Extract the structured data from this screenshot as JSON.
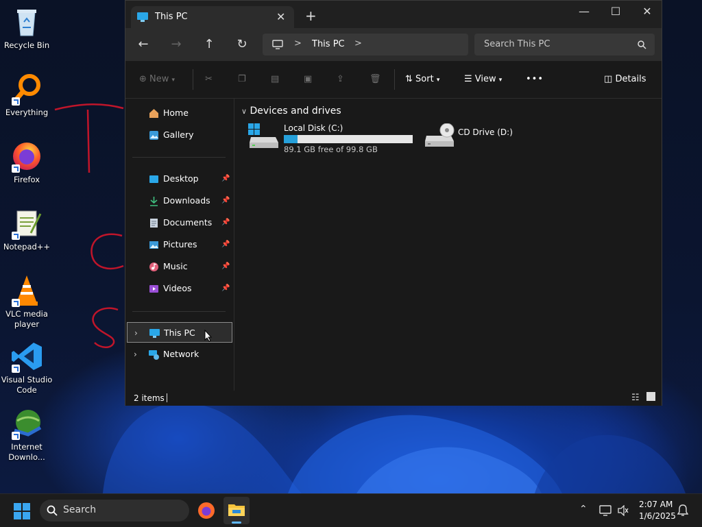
{
  "desktop": {
    "icons": [
      {
        "label": "Recycle Bin"
      },
      {
        "label": "Everything"
      },
      {
        "label": "Firefox"
      },
      {
        "label": "Notepad++"
      },
      {
        "label": "VLC media player"
      },
      {
        "label": "Visual Studio Code"
      },
      {
        "label": "Internet Downlo..."
      }
    ]
  },
  "window": {
    "tab_title": "This PC",
    "new_tab": "+",
    "minimize": "—",
    "maximize": "☐",
    "close": "✕",
    "address": {
      "root_sep": ">",
      "location": "This PC",
      "end_sep": ">"
    },
    "search_placeholder": "Search This PC",
    "toolbar": {
      "new_label": "New",
      "sort_label": "Sort",
      "view_label": "View",
      "more_label": "•••",
      "details_label": "Details"
    },
    "sidebar": {
      "quick": [
        {
          "label": "Home",
          "pinned": false
        },
        {
          "label": "Gallery",
          "pinned": false
        }
      ],
      "pinned": [
        {
          "label": "Desktop"
        },
        {
          "label": "Downloads"
        },
        {
          "label": "Documents"
        },
        {
          "label": "Pictures"
        },
        {
          "label": "Music"
        },
        {
          "label": "Videos"
        }
      ],
      "tree": [
        {
          "label": "This PC",
          "selected": true
        },
        {
          "label": "Network",
          "selected": false
        }
      ]
    },
    "content": {
      "group_header": "Devices and drives",
      "drives": [
        {
          "name": "Local Disk (C:)",
          "free_text": "89.1 GB free of 99.8 GB",
          "used_fraction": 0.107
        },
        {
          "name": "CD Drive (D:)"
        }
      ]
    },
    "status": {
      "items": "2 items"
    }
  },
  "taskbar": {
    "search_placeholder": "Search",
    "time": "2:07 AM",
    "date": "1/6/2025"
  },
  "colors": {
    "accent": "#26a0da",
    "selection_border": "#8c8c8c"
  }
}
